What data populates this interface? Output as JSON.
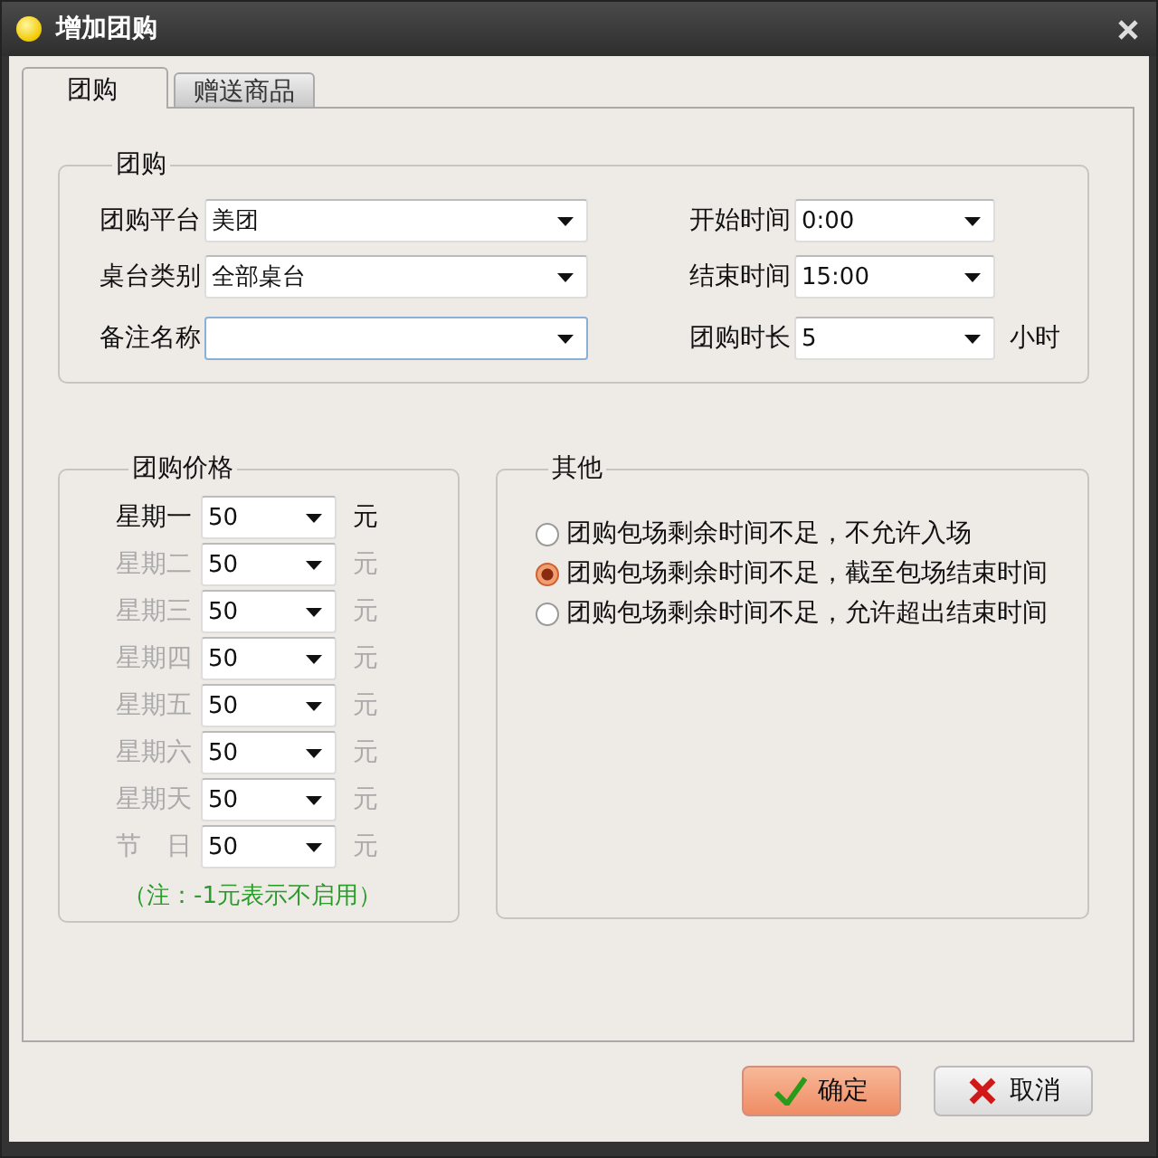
{
  "window": {
    "title": "增加团购"
  },
  "tabs": [
    {
      "label": "团购",
      "selected": true
    },
    {
      "label": "赠送商品",
      "selected": false
    }
  ],
  "group": {
    "title": "团购",
    "fields_left": [
      {
        "label": "团购平台",
        "value": "美团",
        "focused": false
      },
      {
        "label": "桌台类别",
        "value": "全部桌台",
        "focused": false
      },
      {
        "label": "备注名称",
        "focused": true
      }
    ],
    "fields_right": [
      {
        "label": "开始时间",
        "value": "0:00"
      },
      {
        "label": "结束时间",
        "value": "15:00"
      },
      {
        "label": "团购时长",
        "value": "5",
        "unit": "小时"
      }
    ]
  },
  "prices": {
    "title": "团购价格",
    "rows": [
      {
        "label": "星期一",
        "value": "50",
        "unit": "元",
        "disabled": false
      },
      {
        "label": "星期二",
        "value": "50",
        "unit": "元",
        "disabled": true
      },
      {
        "label": "星期三",
        "value": "50",
        "unit": "元",
        "disabled": true
      },
      {
        "label": "星期四",
        "value": "50",
        "unit": "元",
        "disabled": true
      },
      {
        "label": "星期五",
        "value": "50",
        "unit": "元",
        "disabled": true
      },
      {
        "label": "星期六",
        "value": "50",
        "unit": "元",
        "disabled": true
      },
      {
        "label": "星期天",
        "value": "50",
        "unit": "元",
        "disabled": true
      },
      {
        "label": "节　日",
        "value": "50",
        "unit": "元",
        "disabled": true
      }
    ],
    "note": "（注：-1元表示不启用）"
  },
  "other": {
    "title": "其他",
    "options": [
      {
        "label": "团购包场剩余时间不足，不允许入场",
        "selected": false
      },
      {
        "label": "团购包场剩余时间不足，截至包场结束时间",
        "selected": true
      },
      {
        "label": "团购包场剩余时间不足，允许超出结束时间",
        "selected": false
      }
    ]
  },
  "buttons": [
    {
      "label": "确定",
      "kind": "ok"
    },
    {
      "label": "取消",
      "kind": "cancel"
    }
  ]
}
